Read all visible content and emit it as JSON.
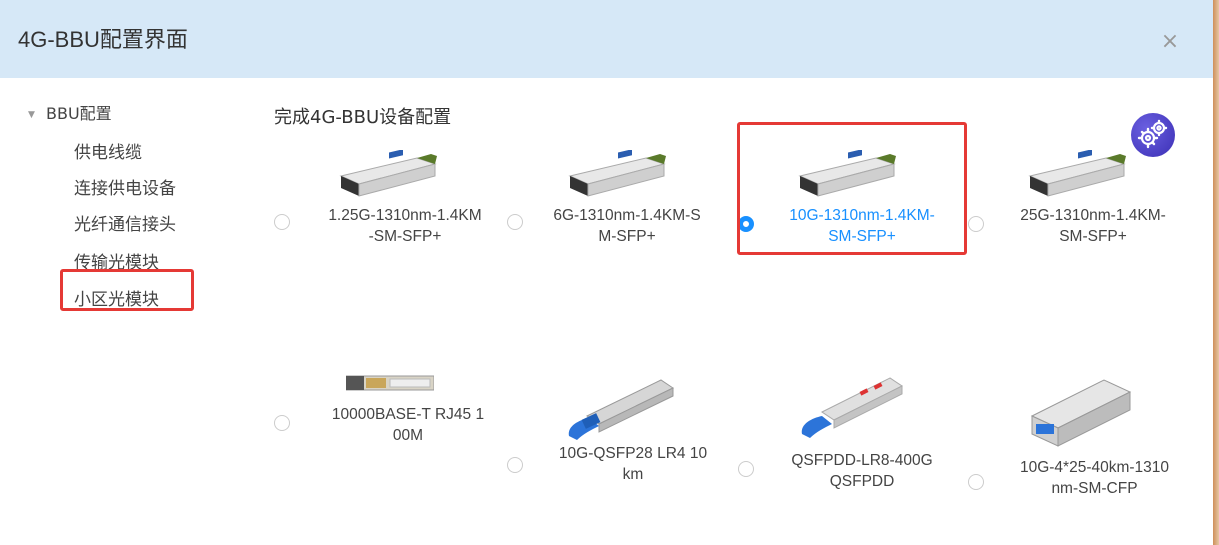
{
  "header": {
    "title": "4G-BBU配置界面",
    "close_glyph": "×"
  },
  "tree": {
    "root_label": "BBU配置",
    "root_caret": "▼",
    "items": [
      "供电线缆",
      "连接供电设备",
      "光纤通信接头",
      "传输光模块",
      "小区光模块"
    ]
  },
  "main": {
    "prompt": "完成4G-BBU设备配置",
    "selected_index": 2,
    "options": [
      {
        "line1": "1.25G-1310nm-1.4KM",
        "line2": "-SM-SFP+",
        "icon": "sfp-module-icon"
      },
      {
        "line1": "6G-1310nm-1.4KM-S",
        "line2": "M-SFP+",
        "icon": "sfp-module-icon"
      },
      {
        "line1": "10G-1310nm-1.4KM-",
        "line2": "SM-SFP+",
        "icon": "sfp-module-icon"
      },
      {
        "line1": "25G-1310nm-1.4KM-",
        "line2": "SM-SFP+",
        "icon": "sfp-module-icon"
      },
      {
        "line1": "10000BASE-T RJ45 1",
        "line2": "00M",
        "icon": "rj45-module-icon"
      },
      {
        "line1": "10G-QSFP28 LR4 10",
        "line2": "km",
        "icon": "qsfp-module-icon"
      },
      {
        "line1": "QSFPDD-LR8-400G",
        "line2": "QSFPDD",
        "icon": "qsfpdd-module-icon"
      },
      {
        "line1": "10G-4*25-40km-1310",
        "line2": "nm-SM-CFP",
        "icon": "cfp-module-icon"
      }
    ]
  },
  "colors": {
    "header_bg": "#d6e8f7",
    "accent": "#1890ff",
    "highlight": "#e53935"
  }
}
